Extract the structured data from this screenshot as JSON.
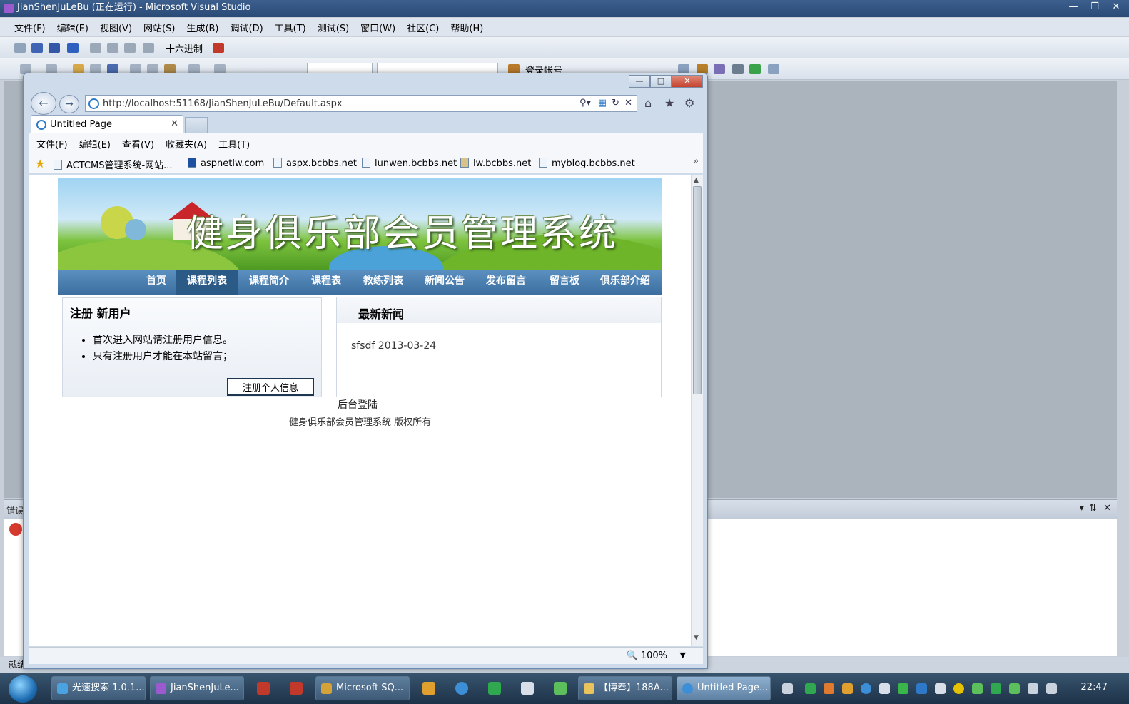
{
  "vs": {
    "title": "JianShenJuLeBu (正在运行) - Microsoft Visual Studio",
    "menu": [
      "文件(F)",
      "编辑(E)",
      "视图(V)",
      "网站(S)",
      "生成(B)",
      "调试(D)",
      "工具(T)",
      "测试(S)",
      "窗口(W)",
      "社区(C)",
      "帮助(H)"
    ],
    "hex_label": "十六进制",
    "account_label": "登录帐号",
    "error_panel_title": "错误",
    "status": "就绪"
  },
  "ie": {
    "address": "http://localhost:51168/JianShenJuLeBu/Default.aspx",
    "tab_title": "Untitled Page",
    "menu": [
      "文件(F)",
      "编辑(E)",
      "查看(V)",
      "收藏夹(A)",
      "工具(T)"
    ],
    "favorites": [
      "ACTCMS管理系统-网站...",
      "aspnetlw.com",
      "aspx.bcbbs.net",
      "lunwen.bcbbs.net",
      "lw.bcbbs.net",
      "myblog.bcbbs.net"
    ],
    "zoom": "100%"
  },
  "page": {
    "banner_title": "健身俱乐部会员管理系统",
    "nav": [
      "首页",
      "课程列表",
      "课程简介",
      "课程表",
      "教练列表",
      "新闻公告",
      "发布留言",
      "留言板",
      "俱乐部介绍"
    ],
    "nav_active": 1,
    "register": {
      "title": "注册 新用户",
      "items": [
        "首次进入网站请注册用户信息。",
        "只有注册用户才能在本站留言；"
      ],
      "button": "注册个人信息"
    },
    "news": {
      "title": "最新新闻",
      "items": [
        "sfsdf 2013-03-24"
      ]
    },
    "admin_link": "后台登陆",
    "copyright": "健身俱乐部会员管理系统  版权所有"
  },
  "taskbar": {
    "tasks": [
      "光速搜索 1.0.1...",
      "JianShenJuLe...",
      "Microsoft SQ...",
      "【博奉】188A...",
      "Untitled Page..."
    ],
    "clock": "22:47"
  }
}
